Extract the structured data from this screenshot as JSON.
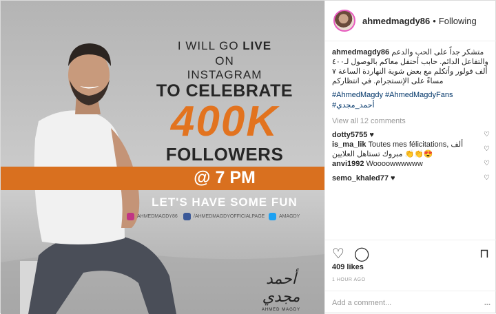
{
  "poster": {
    "line1_prefix": "I WILL GO ",
    "line1_bold": "LIVE",
    "line2": "ON",
    "line3": "INSTAGRAM",
    "line4": "TO CELEBRATE",
    "number": "400K",
    "line5": "FOLLOWERS",
    "band": "@ 7 PM",
    "fun": "LET'S HAVE SOME FUN",
    "social_instagram": "AHMEDMAGDY86",
    "social_facebook": "/AHMEDMAGDYOFFICIALPAGE",
    "social_twitter": "AMAGDY",
    "signature_ar": "أحمد مجدي",
    "signature_en": "AHMED MAGDY",
    "colors": {
      "accent": "#d9701f",
      "number": "#e2731f",
      "instagram": "#c13584",
      "facebook": "#3b5998",
      "twitter": "#1da1f2"
    }
  },
  "header": {
    "username": "ahmedmagdy86",
    "separator": "•",
    "follow_state": "Following"
  },
  "caption": {
    "username": "ahmedmagdy86",
    "text": "متشكر جداً على الحب والدعم والتفاعل الدائم. حابب أحتفل معاكم بالوصول لـ٤٠٠ ألف فولور وأتكلم مع بعض شوية النهاردة الساعة ٧ مساءً على الإنستجرام. في انتظاركم",
    "hashtags": "#AhmedMagdy #AhmedMagdyFans",
    "hashtag_ar": "#أحمد_مجدي"
  },
  "view_all": "View all 12 comments",
  "comments": [
    {
      "user": "dotty5755",
      "text": "♥"
    },
    {
      "user": "is_ma_lik",
      "text": "Toutes mes félicitations, ألف مبروك تستاهل العلايين 👏👏😍"
    },
    {
      "user": "anvi1992",
      "text": "Woooowwwwww"
    },
    {
      "user": "semo_khaled77",
      "text": "♥"
    }
  ],
  "likes": "409 likes",
  "time": "1 HOUR AGO",
  "add_comment_placeholder": "Add a comment...",
  "more": "..."
}
